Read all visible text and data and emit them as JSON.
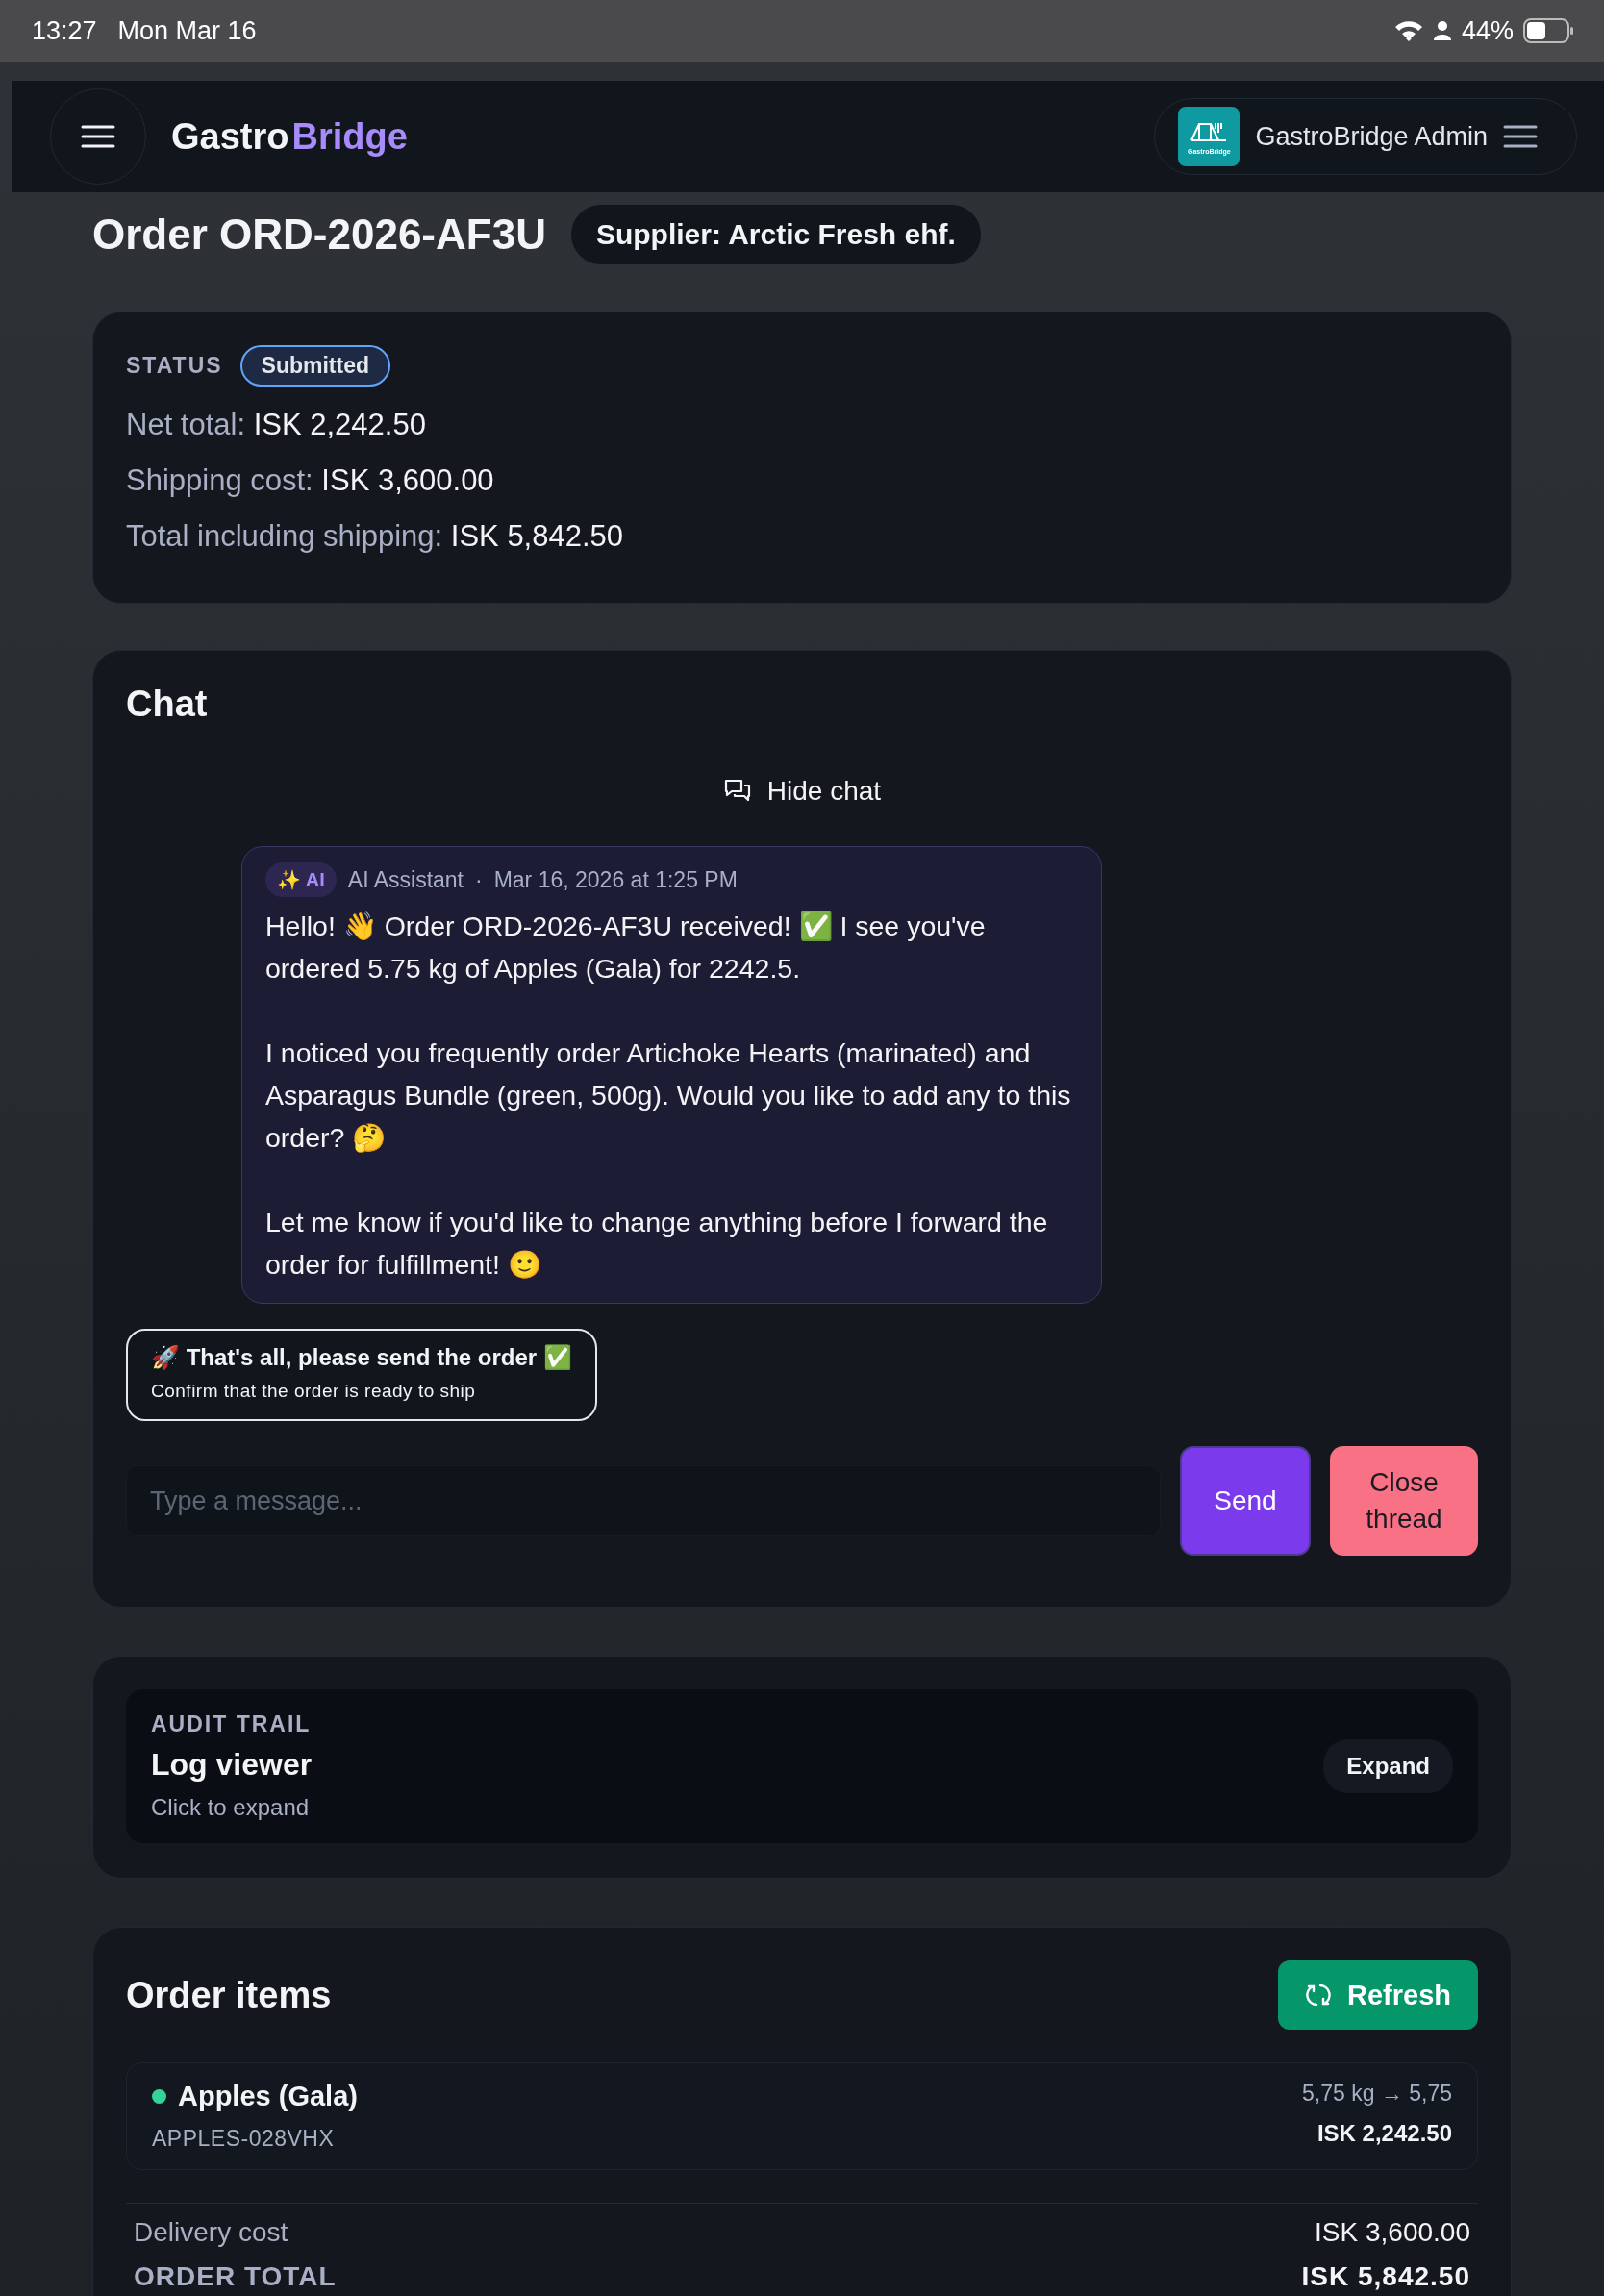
{
  "status_bar": {
    "time": "13:27",
    "date": "Mon Mar 16",
    "battery": "44%"
  },
  "header": {
    "brand_first": "Gastro",
    "brand_second": "Bridge",
    "logo_caption": "GastroBridge",
    "account": "GastroBridge Admin"
  },
  "order": {
    "title": "Order ORD-2026-AF3U",
    "supplier": "Supplier: Arctic Fresh ehf."
  },
  "summary": {
    "status_label": "STATUS",
    "status": "Submitted",
    "lines": [
      {
        "label": "Net total:",
        "value": "ISK 2,242.50"
      },
      {
        "label": "Shipping cost:",
        "value": "ISK 3,600.00"
      },
      {
        "label": "Total including shipping:",
        "value": "ISK 5,842.50"
      }
    ]
  },
  "chat": {
    "title": "Chat",
    "toggle": "Hide chat",
    "messages": [
      {
        "badge": "✨ AI",
        "author": "AI Assistant",
        "separator": "·",
        "time": "Mar 16, 2026 at 1:25 PM",
        "paragraphs": [
          "Hello! 👋 Order ORD-2026-AF3U received! ✅ I see you've ordered 5.75 kg of Apples (Gala) for 2242.5.",
          "I noticed you frequently order Artichoke Hearts (marinated) and Asparagus Bundle (green, 500g). Would you like to add any to this order? 🤔",
          "Let me know if you'd like to change anything before I forward the order for fulfillment! 🙂"
        ]
      }
    ],
    "quick_replies": [
      {
        "title": "🚀 That's all, please send the order ✅",
        "subtitle": "Confirm that the order is ready to ship"
      }
    ],
    "input": {
      "placeholder": "Type a message..."
    },
    "buttons": [
      {
        "label": "Send",
        "kind": "primary"
      },
      {
        "label": "Close thread",
        "kind": "danger"
      }
    ]
  },
  "audit": {
    "eyebrow": "AUDIT TRAIL",
    "title": "Log viewer",
    "hint": "Click to expand",
    "button": "Expand"
  },
  "order_items": {
    "title": "Order items",
    "refresh": "Refresh",
    "items": [
      {
        "name": "Apples (Gala)",
        "sku": "APPLES-028VHX",
        "quantity": "5,75 kg → 5,75",
        "price": "ISK 2,242.50",
        "color": "#34d399"
      }
    ],
    "totals": [
      {
        "label": "Delivery cost",
        "value": "ISK 3,600.00",
        "kind": "line"
      },
      {
        "label": "ORDER TOTAL",
        "value": "ISK 5,842.50",
        "kind": "total"
      }
    ]
  }
}
